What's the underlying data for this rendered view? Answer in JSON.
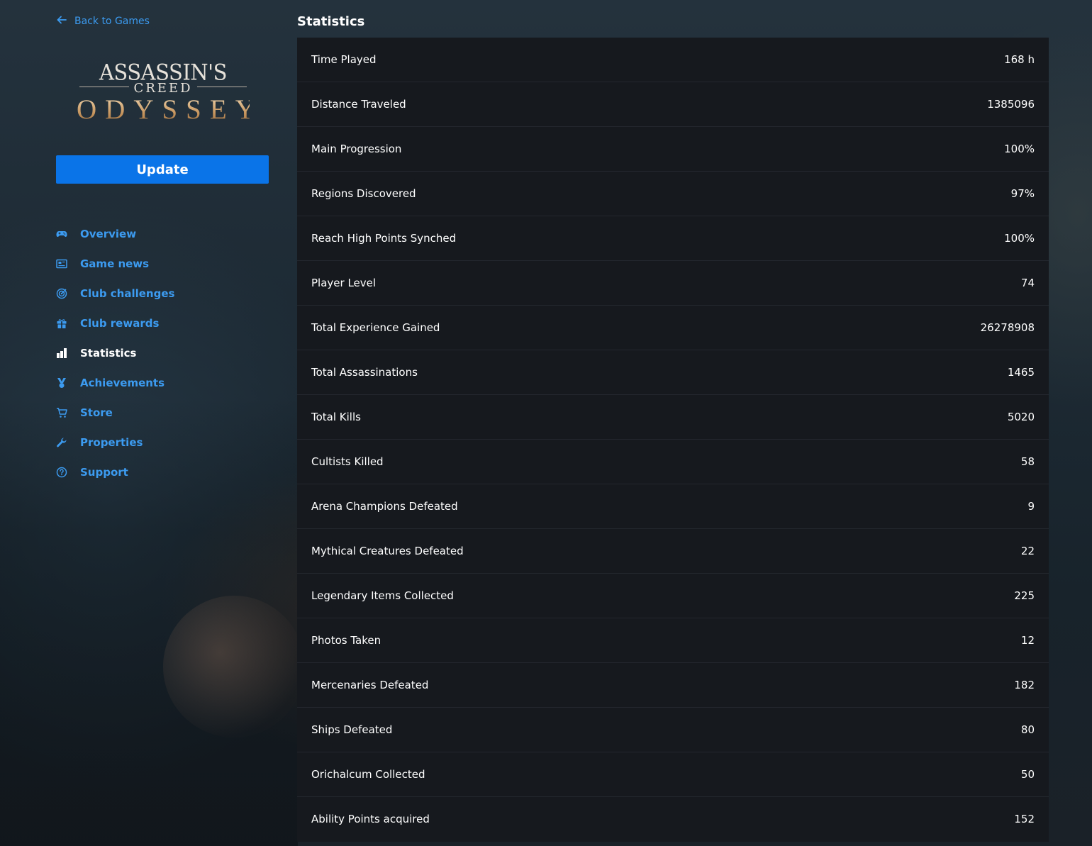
{
  "back_link": {
    "label": "Back to Games"
  },
  "game": {
    "logo_line1": "ASSASSIN'S",
    "logo_line2": "CREED",
    "logo_line3": "ODYSSEY"
  },
  "update_button": {
    "label": "Update"
  },
  "nav": {
    "items": [
      {
        "label": "Overview",
        "icon": "gamepad-icon",
        "active": false
      },
      {
        "label": "Game news",
        "icon": "news-icon",
        "active": false
      },
      {
        "label": "Club challenges",
        "icon": "target-icon",
        "active": false
      },
      {
        "label": "Club rewards",
        "icon": "gift-icon",
        "active": false
      },
      {
        "label": "Statistics",
        "icon": "bar-chart-icon",
        "active": true
      },
      {
        "label": "Achievements",
        "icon": "medal-icon",
        "active": false
      },
      {
        "label": "Store",
        "icon": "cart-icon",
        "active": false
      },
      {
        "label": "Properties",
        "icon": "wrench-icon",
        "active": false
      },
      {
        "label": "Support",
        "icon": "help-circle-icon",
        "active": false
      }
    ]
  },
  "main": {
    "title": "Statistics",
    "stats": [
      {
        "label": "Time Played",
        "value": "168 h"
      },
      {
        "label": "Distance Traveled",
        "value": "1385096"
      },
      {
        "label": "Main Progression",
        "value": "100%"
      },
      {
        "label": "Regions Discovered",
        "value": "97%"
      },
      {
        "label": "Reach High Points Synched",
        "value": "100%"
      },
      {
        "label": "Player Level",
        "value": "74"
      },
      {
        "label": "Total Experience Gained",
        "value": "26278908"
      },
      {
        "label": "Total Assassinations",
        "value": "1465"
      },
      {
        "label": "Total Kills",
        "value": "5020"
      },
      {
        "label": "Cultists Killed",
        "value": "58"
      },
      {
        "label": "Arena Champions Defeated",
        "value": "9"
      },
      {
        "label": "Mythical Creatures Defeated",
        "value": "22"
      },
      {
        "label": "Legendary Items Collected",
        "value": "225"
      },
      {
        "label": "Photos Taken",
        "value": "12"
      },
      {
        "label": "Mercenaries Defeated",
        "value": "182"
      },
      {
        "label": "Ships Defeated",
        "value": "80"
      },
      {
        "label": "Orichalcum Collected",
        "value": "50"
      },
      {
        "label": "Ability Points acquired",
        "value": "152"
      }
    ]
  },
  "colors": {
    "accent": "#3c9bf0",
    "button": "#0a74e8",
    "table_bg": "#16191e",
    "row_divider": "#23272e"
  }
}
